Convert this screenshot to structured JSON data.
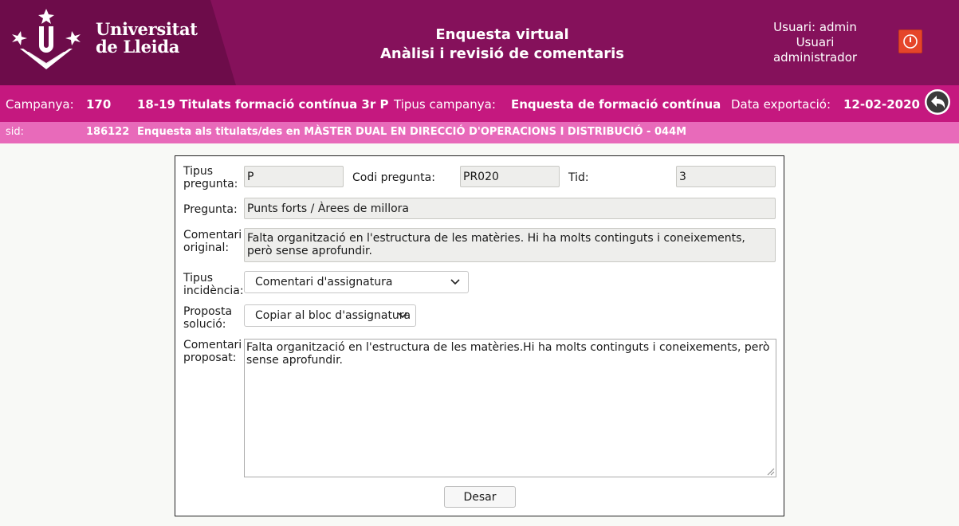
{
  "header": {
    "logo_text": "Universitat\nde Lleida",
    "title_line1": "Enquesta virtual",
    "title_line2": "Anàlisi i revisió de comentaris",
    "user_line": "Usuari: admin",
    "user_role": "Usuari administrador",
    "colors": {
      "header_bg": "#85115b",
      "logo_panel": "#6d0c4a",
      "campaign_bar": "#c5187f",
      "sid_bar": "#e86aba",
      "logout": "#e5452a"
    },
    "icons": {
      "logout": "power-icon",
      "back": "undo-arrow-icon",
      "logo": "udl-logo-icon"
    }
  },
  "campaign": {
    "campaign_label": "Campanya:",
    "campaign_id": "170",
    "campaign_name": "18-19 Titulats formació contínua 3r P",
    "type_label": "Tipus campanya:",
    "type_value": "Enquesta de formació contínua",
    "export_label": "Data exportació:",
    "export_date": "12-02-2020"
  },
  "sid": {
    "label": "sid:",
    "value": "186122",
    "description": "Enquesta als titulats/des en MÀSTER DUAL EN DIRECCIÓ D'OPERACIONS I DISTRIBUCIÓ - 044M"
  },
  "form": {
    "tipus_pregunta_label": "Tipus\npregunta:",
    "tipus_pregunta_value": "P",
    "codi_pregunta_label": "Codi pregunta:",
    "codi_pregunta_value": "PR020",
    "tid_label": "Tid:",
    "tid_value": "3",
    "pregunta_label": "Pregunta:",
    "pregunta_value": "Punts forts / Àrees de millora",
    "comentari_original_label": "Comentari\noriginal:",
    "comentari_original_value": "Falta organització en l'estructura de les matèries. Hi ha molts continguts i coneixements, però sense aprofundir.",
    "tipus_incidencia_label": "Tipus\nincidència:",
    "tipus_incidencia_value": "Comentari d'assignatura",
    "proposta_solucio_label": "Proposta\nsolució:",
    "proposta_solucio_value": "Copiar al bloc d'assignatura",
    "comentari_proposat_label": "Comentari\nproposat:",
    "comentari_proposat_value": "Falta organització en l'estructura de les matèries.Hi ha molts continguts i coneixements, però sense aprofundir.",
    "save_label": "Desar"
  }
}
